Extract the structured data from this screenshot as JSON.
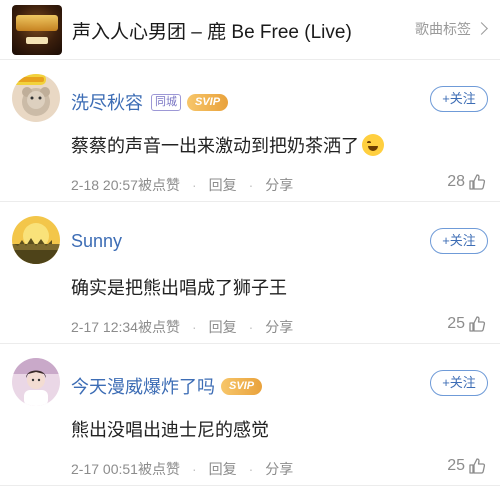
{
  "header": {
    "title": "声入人心男团 – 鹿 Be Free (Live)",
    "tag_label": "歌曲标签",
    "tag_icon": "chevron-right-icon"
  },
  "colors": {
    "username": "#3d6db5",
    "follow_border": "#6f9bd8",
    "svip": "#e9a23c",
    "text": "#222222",
    "meta": "#8c8c8c"
  },
  "comments": [
    {
      "username": "洗尽秋容",
      "badges": [
        "同城",
        "SVIP"
      ],
      "follow_label": "+关注",
      "text": "蔡蔡的声音一出来激动到把奶茶洒了",
      "emoji": "laugh-cry-emoji",
      "date": "2-18 20:57",
      "liked_by": "被点赞",
      "reply_label": "回复",
      "share_label": "分享",
      "likes": "28"
    },
    {
      "username": "Sunny",
      "badges": [],
      "follow_label": "+关注",
      "text": "确实是把熊出唱成了狮子王",
      "date": "2-17 12:34",
      "liked_by": "被点赞",
      "reply_label": "回复",
      "share_label": "分享",
      "likes": "25"
    },
    {
      "username": "今天漫威爆炸了吗",
      "badges": [
        "SVIP"
      ],
      "follow_label": "+关注",
      "text": "熊出没唱出迪士尼的感觉",
      "date": "2-17 00:51",
      "liked_by": "被点赞",
      "reply_label": "回复",
      "share_label": "分享",
      "likes": "25"
    }
  ]
}
